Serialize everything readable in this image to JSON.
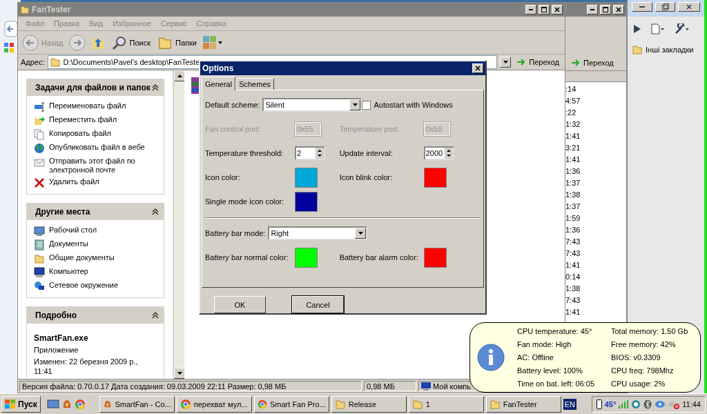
{
  "explorer": {
    "title": "FanTester",
    "menu": [
      "Файл",
      "Правка",
      "Вид",
      "Избранное",
      "Сервис",
      "Справка"
    ],
    "toolbar": {
      "back": "Назад",
      "search": "Поиск",
      "folders": "Папки"
    },
    "address_label": "Адрес:",
    "address": "D:\\Documents\\Pavel's desktop\\FanTeste",
    "go": "Переход",
    "panels": [
      {
        "title": "Задачи для файлов и папок",
        "items": [
          "Переименовать файл",
          "Переместить файл",
          "Копировать файл",
          "Опубликовать файл в вебе",
          "Отправить этот файл по электронной почте",
          "Удалить файл"
        ]
      },
      {
        "title": "Другие места",
        "items": [
          "Рабочий стол",
          "Документы",
          "Общие документы",
          "Компьютер",
          "Сетевое окружение"
        ]
      }
    ],
    "details": {
      "title": "Подробно",
      "name": "SmartFan.exe",
      "type": "Приложение",
      "modified": "Изменен: 22 березня 2009 р., 11:41"
    },
    "status": [
      "Версия файла: 0.70.0.17 Дата создания: 09.03.2009 22:11 Размер: 0,98 МБ",
      "0,98 МБ",
      "Мой компь"
    ]
  },
  "second_window": {
    "go": "Переход",
    "times": [
      ":14",
      "4:57",
      ":22",
      "1:32",
      "1:41",
      "3:21",
      "1:41",
      "1:36",
      "1:37",
      "1:38",
      "1:37",
      "1:59",
      "1:36",
      "7:43",
      "7:43",
      "1:41",
      "0:14",
      "1:38",
      "7:43",
      "1:41"
    ]
  },
  "browser": {
    "bookmark": "Інші закладки"
  },
  "dialog": {
    "title": "Options",
    "tabs": [
      {
        "label": "General",
        "selected": true
      },
      {
        "label": "Schemes",
        "selected": false
      }
    ],
    "sections": [
      {
        "rows": [
          [
            {
              "kind": "select",
              "label": "Default scheme:",
              "value": "Silent"
            },
            {
              "kind": "checkbox",
              "label": "Autostart with Windows",
              "checked": false
            }
          ],
          [
            {
              "kind": "text",
              "label": "Fan control port:",
              "value": "0x55",
              "disabled": true
            },
            {
              "kind": "text",
              "label": "Temperature port:",
              "value": "0x58",
              "disabled": true
            }
          ],
          [
            {
              "kind": "spin",
              "label": "Temperature threshold:",
              "value": "2"
            },
            {
              "kind": "spin",
              "label": "Update interval:",
              "value": "2000"
            }
          ],
          [
            {
              "kind": "color",
              "label": "Icon color:",
              "color": "#00a8d8"
            },
            {
              "kind": "color",
              "label": "Icon blink color:",
              "color": "#ff0000"
            }
          ],
          [
            {
              "kind": "color",
              "label": "Single mode icon color:",
              "color": "#00009c"
            }
          ]
        ]
      },
      {
        "rows": [
          [
            {
              "kind": "select",
              "label": "Battery bar mode:",
              "value": "Right"
            }
          ],
          [
            {
              "kind": "color",
              "label": "Battery bar normal color:",
              "color": "#00ff00"
            },
            {
              "kind": "color",
              "label": "Battery bar alarm color:",
              "color": "#ff0000"
            }
          ]
        ]
      }
    ],
    "buttons": [
      "OK",
      "Cancel"
    ]
  },
  "balloon": {
    "left": [
      "CPU temperature: 45°",
      "Fan mode: High",
      "AC: Offline",
      "Battery level: 100%",
      "Time on bat. left: 06:05"
    ],
    "right": [
      "Total memory: 1.50 Gb",
      "Free memory: 42%",
      "BIOS:  v0.3309",
      "CPU freq: 798Mhz",
      "CPU usage: 2%"
    ]
  },
  "taskbar": {
    "start": "Пуск",
    "tasks": [
      {
        "kind": "app",
        "label": "SmartFan - Co..."
      },
      {
        "kind": "browser",
        "label": "перехват мул..."
      },
      {
        "kind": "browser",
        "label": "Smart Fan Pro..."
      },
      {
        "kind": "folder",
        "label": "Release"
      },
      {
        "kind": "folder",
        "label": "1"
      },
      {
        "kind": "folder",
        "label": "FanTester"
      }
    ],
    "language": "EN",
    "temperature": "45°",
    "clock": "11:44"
  }
}
